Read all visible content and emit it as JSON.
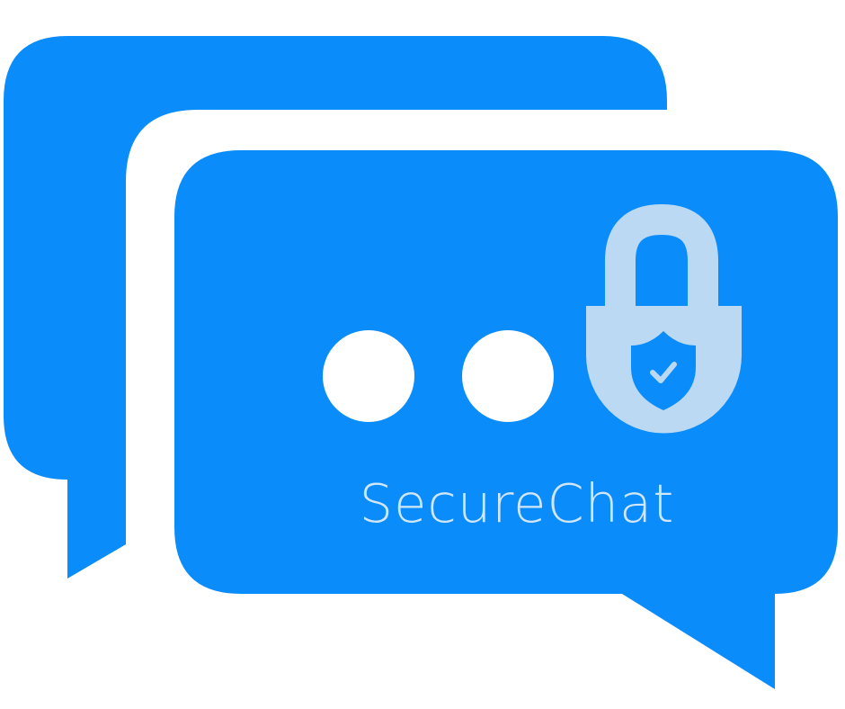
{
  "brand": {
    "name": "SecureChat"
  },
  "colors": {
    "bubble": "#0A8CFA",
    "background": "#FFFFFF",
    "dots": "#FFFFFF",
    "lock": "#BCD9F4",
    "text": "#D0E6FB"
  },
  "icons": {
    "back_bubble": "chat-bubble-icon",
    "front_bubble": "chat-bubble-icon",
    "typing_dots": "ellipsis-icon",
    "lock": "padlock-icon",
    "shield": "shield-check-icon"
  }
}
